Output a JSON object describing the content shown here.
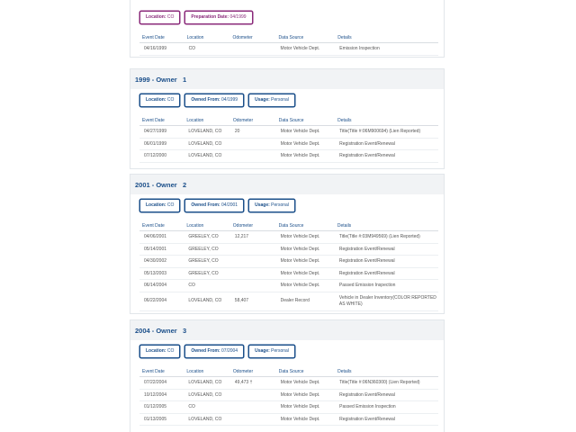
{
  "columns": [
    "Event Date",
    "Location",
    "Odometer",
    "Data Source",
    "Details"
  ],
  "sections": [
    {
      "title": "",
      "pills": [
        {
          "label": "Location:",
          "value": "CO",
          "color": "#8a2a7a"
        },
        {
          "label": "Preparation Date:",
          "value": "04/1999",
          "color": "#8a2a7a"
        }
      ],
      "rows": [
        [
          "04/16/1999",
          "CO",
          "",
          "Motor Vehicle Dept.",
          "Emission Inspection"
        ]
      ]
    },
    {
      "title": "1999 - Owner   1",
      "pills": [
        {
          "label": "Location:",
          "value": "CO",
          "color": "#1b4f8a"
        },
        {
          "label": "Owned From:",
          "value": "04/1999",
          "color": "#1b4f8a"
        },
        {
          "label": "Usage:",
          "value": "Personal",
          "color": "#1b4f8a"
        }
      ],
      "rows": [
        [
          "04/27/1999",
          "LOVELAND, CO",
          "20",
          "Motor Vehicle Dept.",
          "Title(Title #:06M900694) (Lien Reported)"
        ],
        [
          "06/01/1999",
          "LOVELAND, CO",
          "",
          "Motor Vehicle Dept.",
          "Registration Event/Renewal"
        ],
        [
          "07/12/2000",
          "LOVELAND, CO",
          "",
          "Motor Vehicle Dept.",
          "Registration Event/Renewal"
        ]
      ]
    },
    {
      "title": "2001 - Owner   2",
      "pills": [
        {
          "label": "Location:",
          "value": "CO",
          "color": "#1b4f8a"
        },
        {
          "label": "Owned From:",
          "value": "04/2001",
          "color": "#1b4f8a"
        },
        {
          "label": "Usage:",
          "value": "Personal",
          "color": "#1b4f8a"
        }
      ],
      "rows": [
        [
          "04/06/2001",
          "GREELEY, CO",
          "12,217",
          "Motor Vehicle Dept.",
          "Title(Title #:03M949569) (Lien Reported)"
        ],
        [
          "05/14/2001",
          "GREELEY, CO",
          "",
          "Motor Vehicle Dept.",
          "Registration Event/Renewal"
        ],
        [
          "04/30/2002",
          "GREELEY, CO",
          "",
          "Motor Vehicle Dept.",
          "Registration Event/Renewal"
        ],
        [
          "05/13/2003",
          "GREELEY, CO",
          "",
          "Motor Vehicle Dept.",
          "Registration Event/Renewal"
        ],
        [
          "06/14/2004",
          "CO",
          "",
          "Motor Vehicle Dept.",
          "Passed Emission Inspection"
        ],
        [
          "06/22/2004",
          "LOVELAND, CO",
          "58,407",
          "Dealer Record",
          "Vehicle in Dealer Inventory(COLOR REPORTED AS WHITE)"
        ]
      ]
    },
    {
      "title": "2004 - Owner   3",
      "pills": [
        {
          "label": "Location:",
          "value": "CO",
          "color": "#1b4f8a"
        },
        {
          "label": "Owned From:",
          "value": "07/2004",
          "color": "#1b4f8a"
        },
        {
          "label": "Usage:",
          "value": "Personal",
          "color": "#1b4f8a"
        }
      ],
      "rows": [
        [
          "07/22/2004",
          "LOVELAND, CO",
          "49,473 †",
          "Motor Vehicle Dept.",
          "Title(Title #:06N360300) (Lien Reported)"
        ],
        [
          "10/12/2004",
          "LOVELAND, CO",
          "",
          "Motor Vehicle Dept.",
          "Registration Event/Renewal"
        ],
        [
          "01/12/2005",
          "CO",
          "",
          "Motor Vehicle Dept.",
          "Passed Emission Inspection"
        ],
        [
          "01/13/2005",
          "LOVELAND, CO",
          "",
          "Motor Vehicle Dept.",
          "Registration Event/Renewal"
        ]
      ]
    }
  ]
}
